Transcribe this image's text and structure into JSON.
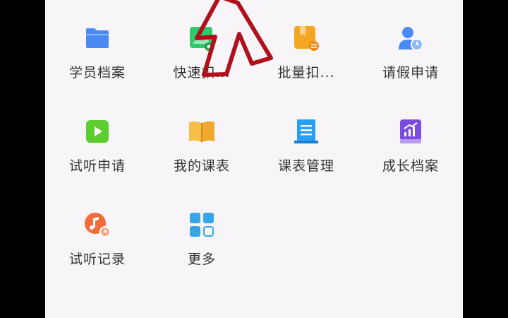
{
  "menu": {
    "items": [
      {
        "label": "学员档案",
        "icon": "folder-icon",
        "color": "#4a8af4"
      },
      {
        "label": "快速扣...",
        "icon": "image-icon",
        "color": "#2dc96b"
      },
      {
        "label": "批量扣...",
        "icon": "bookmark-card-icon",
        "color": "#f5a623"
      },
      {
        "label": "请假申请",
        "icon": "user-clock-icon",
        "color": "#4a8af4"
      },
      {
        "label": "试听申请",
        "icon": "play-icon",
        "color": "#5ccd2f"
      },
      {
        "label": "我的课表",
        "icon": "open-book-icon",
        "color": "#f6c048"
      },
      {
        "label": "课表管理",
        "icon": "document-icon",
        "color": "#2a9df4"
      },
      {
        "label": "成长档案",
        "icon": "growth-book-icon",
        "color": "#7b4ce0"
      },
      {
        "label": "试听记录",
        "icon": "music-clock-icon",
        "color": "#f26b3a"
      },
      {
        "label": "更多",
        "icon": "grid-icon",
        "color": "#37a6e6"
      }
    ]
  },
  "annotation": {
    "icon": "red-arrow-icon",
    "color": "#b0101b"
  }
}
